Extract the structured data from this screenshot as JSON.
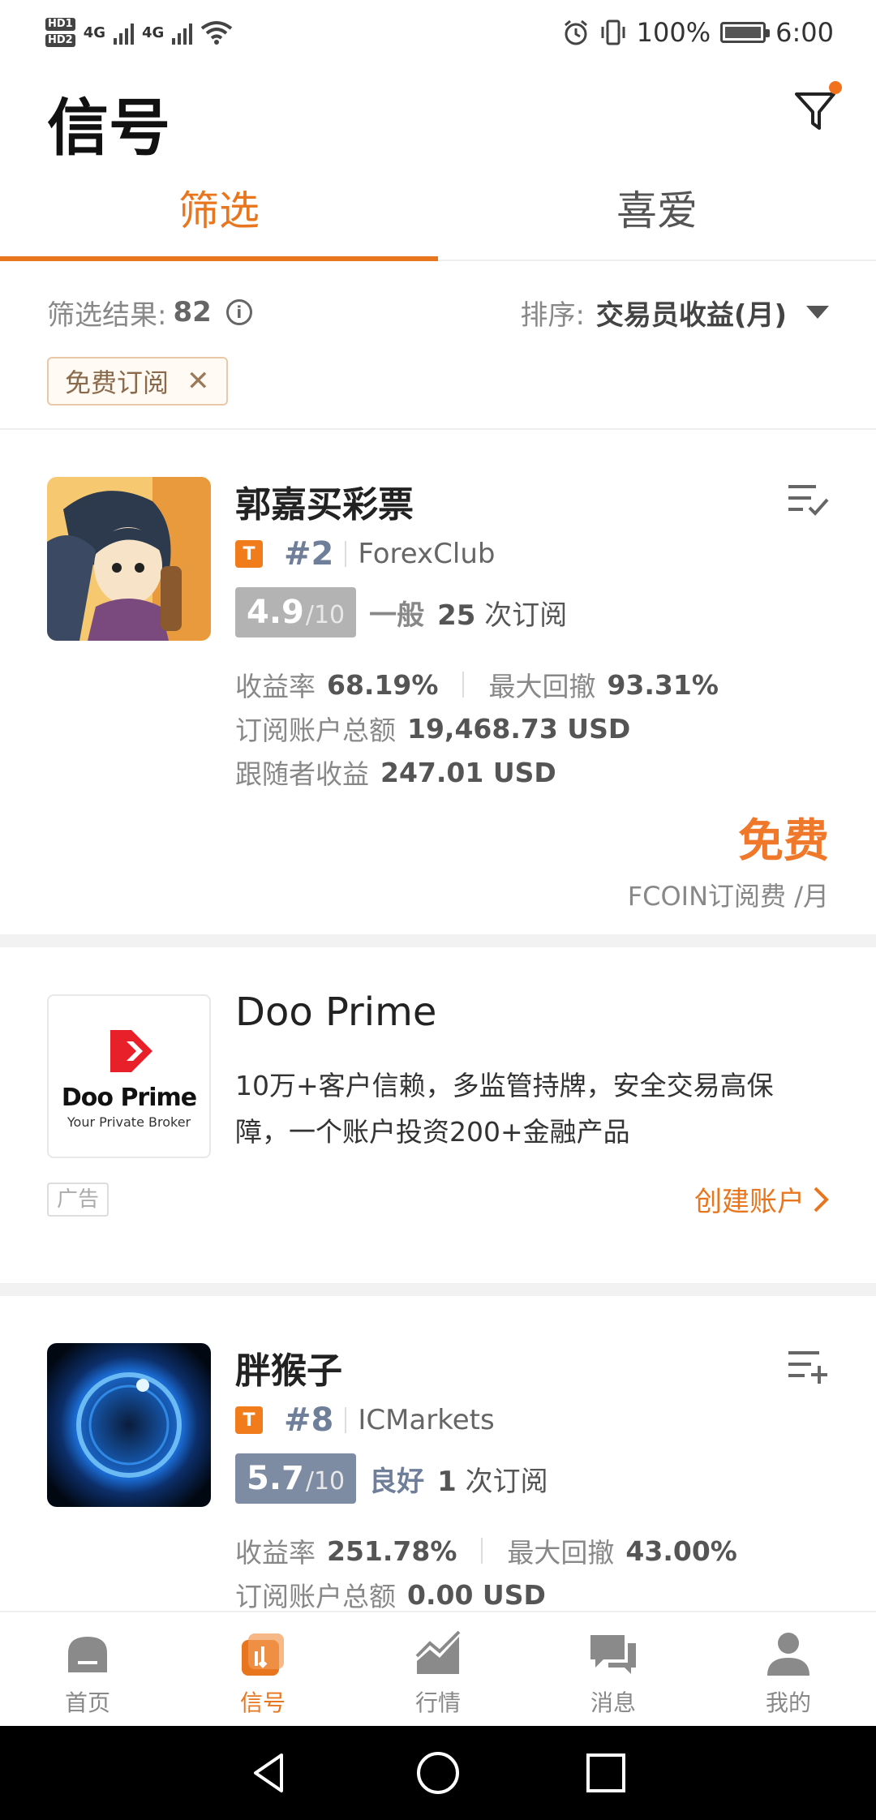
{
  "status_bar": {
    "hd1": "HD1",
    "hd2": "HD2",
    "net1": "4G",
    "net2": "4G",
    "battery_pct": "100%",
    "time": "6:00"
  },
  "header": {
    "title": "信号"
  },
  "tabs": [
    {
      "label": "筛选",
      "active": true
    },
    {
      "label": "喜爱",
      "active": false
    }
  ],
  "results": {
    "label": "筛选结果:",
    "count": "82",
    "sort_label": "排序:",
    "sort_value": "交易员收益(月)"
  },
  "filter_chip": {
    "label": "免费订阅"
  },
  "signals": [
    {
      "name": "郭嘉买彩票",
      "badge": "T",
      "rank": "#2",
      "broker": "ForexClub",
      "score": "4.9",
      "score_max": "/10",
      "quality": "一般",
      "subs_count": "25",
      "subs_label": "次订阅",
      "return_label": "收益率",
      "return_value": "68.19%",
      "drawdown_label": "最大回撤",
      "drawdown_value": "93.31%",
      "total_label": "订阅账户总额",
      "total_value": "19,468.73 USD",
      "follower_label": "跟随者收益",
      "follower_value": "247.01 USD",
      "price": "免费",
      "price_unit": "FCOIN订阅费 /月"
    },
    {
      "name": "胖猴子",
      "badge": "T",
      "rank": "#8",
      "broker": "ICMarkets",
      "score": "5.7",
      "score_max": "/10",
      "quality": "良好",
      "subs_count": "1",
      "subs_label": "次订阅",
      "return_label": "收益率",
      "return_value": "251.78%",
      "drawdown_label": "最大回撤",
      "drawdown_value": "43.00%",
      "total_label": "订阅账户总额",
      "total_value": "0.00 USD"
    }
  ],
  "ad": {
    "brand": "Doo Prime",
    "tagline": "Your Private Broker",
    "title": "Doo Prime",
    "description": "10万+客户信赖，多监管持牌，安全交易高保障，一个账户投资200+金融产品",
    "label": "广告",
    "cta": "创建账户"
  },
  "bottom_nav": [
    {
      "label": "首页",
      "icon": "home-icon",
      "active": false
    },
    {
      "label": "信号",
      "icon": "signal-icon",
      "active": true
    },
    {
      "label": "行情",
      "icon": "market-icon",
      "active": false
    },
    {
      "label": "消息",
      "icon": "message-icon",
      "active": false
    },
    {
      "label": "我的",
      "icon": "profile-icon",
      "active": false
    }
  ],
  "colors": {
    "accent": "#e8761e",
    "price": "#f0782a",
    "rank": "#6f7f9a"
  }
}
